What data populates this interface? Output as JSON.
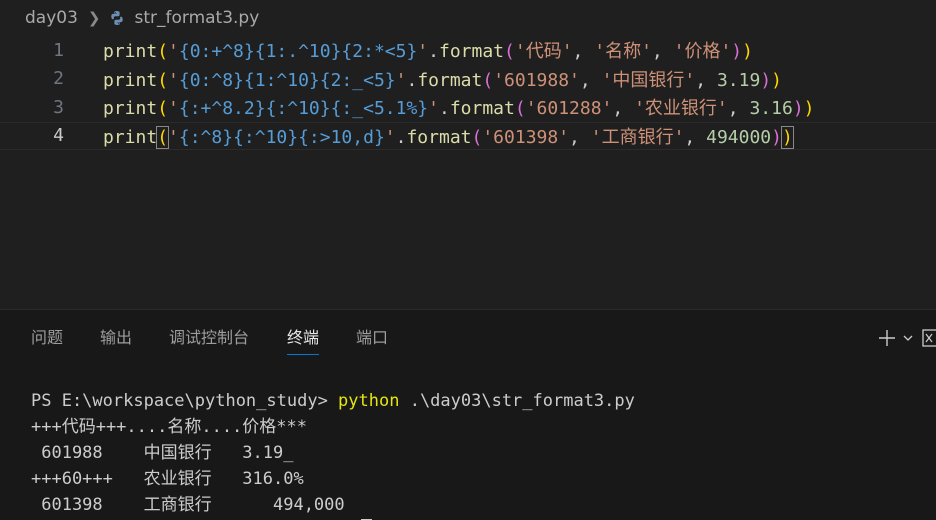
{
  "breadcrumb": {
    "folder": "day03",
    "file": "str_format3.py",
    "file_icon": "python-icon"
  },
  "editor": {
    "lines": [
      {
        "num": "1",
        "tokens": [
          {
            "t": "print",
            "c": "fn"
          },
          {
            "t": "(",
            "c": "p1"
          },
          {
            "t": "'",
            "c": "str"
          },
          {
            "t": "{0:+^8}{1:.^10}{2:*<5}",
            "c": "fmt"
          },
          {
            "t": "'",
            "c": "str"
          },
          {
            "t": ".",
            "c": "plain"
          },
          {
            "t": "format",
            "c": "fn"
          },
          {
            "t": "(",
            "c": "p2"
          },
          {
            "t": "'代码'",
            "c": "str"
          },
          {
            "t": ", ",
            "c": "plain"
          },
          {
            "t": "'名称'",
            "c": "str"
          },
          {
            "t": ", ",
            "c": "plain"
          },
          {
            "t": "'价格'",
            "c": "str"
          },
          {
            "t": ")",
            "c": "p2"
          },
          {
            "t": ")",
            "c": "p1"
          }
        ]
      },
      {
        "num": "2",
        "tokens": [
          {
            "t": "print",
            "c": "fn"
          },
          {
            "t": "(",
            "c": "p1"
          },
          {
            "t": "'",
            "c": "str"
          },
          {
            "t": "{0:^8}{1:^10}{2:_<5}",
            "c": "fmt"
          },
          {
            "t": "'",
            "c": "str"
          },
          {
            "t": ".",
            "c": "plain"
          },
          {
            "t": "format",
            "c": "fn"
          },
          {
            "t": "(",
            "c": "p2"
          },
          {
            "t": "'601988'",
            "c": "str"
          },
          {
            "t": ", ",
            "c": "plain"
          },
          {
            "t": "'中国银行'",
            "c": "str"
          },
          {
            "t": ", ",
            "c": "plain"
          },
          {
            "t": "3.19",
            "c": "num"
          },
          {
            "t": ")",
            "c": "p2"
          },
          {
            "t": ")",
            "c": "p1"
          }
        ]
      },
      {
        "num": "3",
        "tokens": [
          {
            "t": "print",
            "c": "fn"
          },
          {
            "t": "(",
            "c": "p1"
          },
          {
            "t": "'",
            "c": "str"
          },
          {
            "t": "{:+^8.2}{:^10}{:_<5.1%}",
            "c": "fmt"
          },
          {
            "t": "'",
            "c": "str"
          },
          {
            "t": ".",
            "c": "plain"
          },
          {
            "t": "format",
            "c": "fn"
          },
          {
            "t": "(",
            "c": "p2"
          },
          {
            "t": "'601288'",
            "c": "str"
          },
          {
            "t": ", ",
            "c": "plain"
          },
          {
            "t": "'农业银行'",
            "c": "str"
          },
          {
            "t": ", ",
            "c": "plain"
          },
          {
            "t": "3.16",
            "c": "num"
          },
          {
            "t": ")",
            "c": "p2"
          },
          {
            "t": ")",
            "c": "p1"
          }
        ]
      },
      {
        "num": "4",
        "active": true,
        "tokens": [
          {
            "t": "print",
            "c": "fn"
          },
          {
            "t": "(",
            "c": "p1",
            "match": true
          },
          {
            "t": "'",
            "c": "str"
          },
          {
            "t": "{:^8}{:^10}{:>10,d}",
            "c": "fmt"
          },
          {
            "t": "'",
            "c": "str"
          },
          {
            "t": ".",
            "c": "plain"
          },
          {
            "t": "format",
            "c": "fn"
          },
          {
            "t": "(",
            "c": "p2"
          },
          {
            "t": "'601398'",
            "c": "str"
          },
          {
            "t": ", ",
            "c": "plain"
          },
          {
            "t": "'工商银行'",
            "c": "str"
          },
          {
            "t": ", ",
            "c": "plain"
          },
          {
            "t": "494000",
            "c": "num"
          },
          {
            "t": ")",
            "c": "p2"
          },
          {
            "t": ")",
            "c": "p1",
            "match": true
          }
        ]
      }
    ]
  },
  "panel": {
    "tabs": [
      {
        "label": "问题",
        "active": false
      },
      {
        "label": "输出",
        "active": false
      },
      {
        "label": "调试控制台",
        "active": false
      },
      {
        "label": "终端",
        "active": true
      },
      {
        "label": "端口",
        "active": false
      }
    ],
    "actions": {
      "new_terminal_icon": "plus-icon",
      "dropdown_icon": "chevron-down-icon",
      "split_icon": "split-icon"
    }
  },
  "terminal": {
    "prompt": "PS E:\\workspace\\python_study> ",
    "command": "python",
    "args": " .\\day03\\str_format3.py",
    "output": [
      "+++代码+++....名称....价格***",
      " 601988    中国银行   3.19_",
      "+++60+++   农业银行   316.0%",
      " 601398    工商银行      494,000"
    ]
  },
  "colors": {
    "background": "#1f1f1f",
    "panel_background": "#181818",
    "active_tab_underline": "#0078d4",
    "function": "#dcdcaa",
    "string": "#ce9178",
    "format_spec": "#569cd6",
    "number": "#b5cea8",
    "bracket_level1": "#ffd700",
    "bracket_level2": "#da70d6",
    "command": "#e5e510"
  }
}
